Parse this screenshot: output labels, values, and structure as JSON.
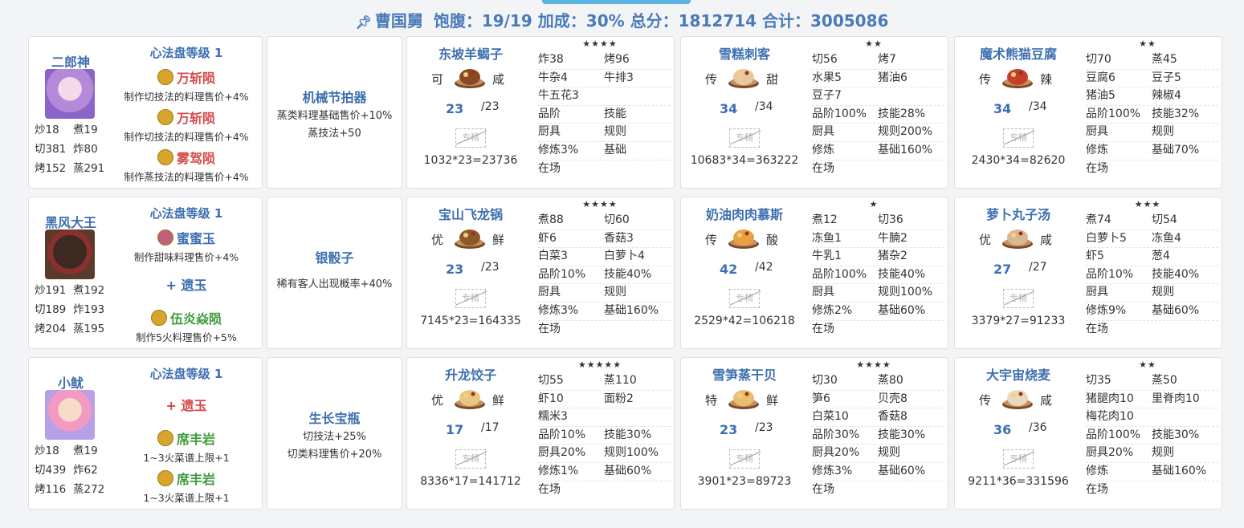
{
  "header": {
    "name": "曹国舅",
    "satiety": "饱腹：19/19",
    "bonus": "加成：30%",
    "score": "总分：1812714",
    "total": "合计：3005086"
  },
  "rows": [
    {
      "chef": {
        "name": "二郎神",
        "stats": [
          [
            "炒18",
            "煮19"
          ],
          [
            "切381",
            "炸80"
          ],
          [
            "烤152",
            "蒸291"
          ]
        ],
        "disk_title": "心法盘等级 1",
        "jades": [
          {
            "name": "万斩陨",
            "desc": "制作切技法的料理售价+4%"
          },
          {
            "name": "万斩陨",
            "desc": "制作切技法的料理售价+4%"
          },
          {
            "name": "雾驾陨",
            "desc": "制作蒸技法的料理售价+4%"
          }
        ]
      },
      "equip": {
        "name": "机械节拍器",
        "desc": [
          "蒸类料理基础售价+10%",
          "蒸技法+50"
        ]
      },
      "recipes": [
        {
          "name": "东坡羊蝎子",
          "stars": "★★★★",
          "tag1": "可",
          "tag2": "咸",
          "qty": "23",
          "max": "23",
          "nofan": "专精",
          "formula": "1032*23=23736",
          "rows": [
            [
              "炸38",
              "烤96"
            ],
            [
              "牛杂4",
              "牛排3"
            ],
            [
              "牛五花3",
              ""
            ],
            [
              "品阶",
              "技能"
            ],
            [
              "厨具",
              "规则"
            ],
            [
              "修炼3%",
              "基础"
            ],
            [
              "在场",
              ""
            ]
          ]
        },
        {
          "name": "雪糕刺客",
          "stars": "★★",
          "tag1": "传",
          "tag2": "甜",
          "qty": "34",
          "max": "34",
          "nofan": "专精",
          "formula": "10683*34=363222",
          "rows": [
            [
              "切56",
              "烤7"
            ],
            [
              "水果5",
              "猪油6"
            ],
            [
              "豆子7",
              ""
            ],
            [
              "品阶100%",
              "技能28%"
            ],
            [
              "厨具",
              "规则200%"
            ],
            [
              "修炼",
              "基础160%"
            ],
            [
              "在场",
              ""
            ]
          ]
        },
        {
          "name": "魔术熊猫豆腐",
          "stars": "★★",
          "tag1": "传",
          "tag2": "辣",
          "qty": "34",
          "max": "34",
          "nofan": "专精",
          "formula": "2430*34=82620",
          "rows": [
            [
              "切70",
              "蒸45"
            ],
            [
              "豆腐6",
              "豆子5"
            ],
            [
              "猪油5",
              "辣椒4"
            ],
            [
              "品阶100%",
              "技能32%"
            ],
            [
              "厨具",
              "规则"
            ],
            [
              "修炼",
              "基础70%"
            ],
            [
              "在场",
              ""
            ]
          ]
        }
      ]
    },
    {
      "chef": {
        "name": "黑风大王",
        "stats": [
          [
            "炒191",
            "煮192"
          ],
          [
            "切189",
            "炸193"
          ],
          [
            "烤204",
            "蒸195"
          ]
        ],
        "disk_title": "心法盘等级 1",
        "jades": [
          {
            "name": "蜜蜜玉",
            "desc": "制作甜味料理售价+4%"
          },
          {
            "name": "+ 遗玉",
            "desc": ""
          },
          {
            "name": "伍炎焱陨",
            "desc": "制作5火料理售价+5%"
          }
        ]
      },
      "equip": {
        "name": "银骰子",
        "desc": [
          "稀有客人出现概率+40%"
        ]
      },
      "recipes": [
        {
          "name": "宝山飞龙锅",
          "stars": "★★★★",
          "tag1": "优",
          "tag2": "鲜",
          "qty": "23",
          "max": "23",
          "nofan": "专精",
          "formula": "7145*23=164335",
          "rows": [
            [
              "煮88",
              "切60"
            ],
            [
              "虾6",
              "香菇3"
            ],
            [
              "白菜3",
              "白萝卜4"
            ],
            [
              "品阶10%",
              "技能40%"
            ],
            [
              "厨具",
              "规则"
            ],
            [
              "修炼3%",
              "基础160%"
            ],
            [
              "在场",
              ""
            ]
          ]
        },
        {
          "name": "奶油肉肉慕斯",
          "stars": "★",
          "tag1": "传",
          "tag2": "酸",
          "qty": "42",
          "max": "42",
          "nofan": "专精",
          "formula": "2529*42=106218",
          "rows": [
            [
              "煮12",
              "切36"
            ],
            [
              "冻鱼1",
              "牛腩2"
            ],
            [
              "牛乳1",
              "猪杂2"
            ],
            [
              "品阶100%",
              "技能40%"
            ],
            [
              "厨具",
              "规则100%"
            ],
            [
              "修炼2%",
              "基础60%"
            ],
            [
              "在场",
              ""
            ]
          ]
        },
        {
          "name": "萝卜丸子汤",
          "stars": "★★★",
          "tag1": "优",
          "tag2": "咸",
          "qty": "27",
          "max": "27",
          "nofan": "专精",
          "formula": "3379*27=91233",
          "rows": [
            [
              "煮74",
              "切54"
            ],
            [
              "白萝卜5",
              "冻鱼4"
            ],
            [
              "虾5",
              "葱4"
            ],
            [
              "品阶10%",
              "技能40%"
            ],
            [
              "厨具",
              "规则"
            ],
            [
              "修炼9%",
              "基础60%"
            ],
            [
              "在场",
              ""
            ]
          ]
        }
      ]
    },
    {
      "chef": {
        "name": "小鱿",
        "stats": [
          [
            "炒18",
            "煮19"
          ],
          [
            "切439",
            "炸62"
          ],
          [
            "烤116",
            "蒸272"
          ]
        ],
        "disk_title": "心法盘等级 1",
        "jades": [
          {
            "name": "+ 遗玉",
            "desc": ""
          },
          {
            "name": "席丰岩",
            "desc": "1~3火菜谱上限+1"
          },
          {
            "name": "席丰岩",
            "desc": "1~3火菜谱上限+1"
          }
        ]
      },
      "equip": {
        "name": "生长宝瓶",
        "desc": [
          "切技法+25%",
          "切类料理售价+20%"
        ]
      },
      "recipes": [
        {
          "name": "升龙饺子",
          "stars": "★★★★★",
          "tag1": "优",
          "tag2": "鲜",
          "qty": "17",
          "max": "17",
          "nofan": "专精",
          "formula": "8336*17=141712",
          "rows": [
            [
              "切55",
              "蒸110"
            ],
            [
              "虾10",
              "面粉2"
            ],
            [
              "糯米3",
              ""
            ],
            [
              "品阶10%",
              "技能30%"
            ],
            [
              "厨具20%",
              "规则100%"
            ],
            [
              "修炼1%",
              "基础60%"
            ],
            [
              "在场",
              ""
            ]
          ]
        },
        {
          "name": "雪笋蒸干贝",
          "stars": "★★★★",
          "tag1": "特",
          "tag2": "鲜",
          "qty": "23",
          "max": "23",
          "nofan": "专精",
          "formula": "3901*23=89723",
          "rows": [
            [
              "切30",
              "蒸80"
            ],
            [
              "笋6",
              "贝壳8"
            ],
            [
              "白菜10",
              "香菇8"
            ],
            [
              "品阶30%",
              "技能30%"
            ],
            [
              "厨具20%",
              "规则"
            ],
            [
              "修炼3%",
              "基础60%"
            ],
            [
              "在场",
              ""
            ]
          ]
        },
        {
          "name": "大宇宙烧麦",
          "stars": "★★",
          "tag1": "传",
          "tag2": "咸",
          "qty": "36",
          "max": "36",
          "nofan": "专精",
          "formula": "9211*36=331596",
          "rows": [
            [
              "切35",
              "蒸50"
            ],
            [
              "猪腿肉10",
              "里脊肉10"
            ],
            [
              "梅花肉10",
              ""
            ],
            [
              "品阶100%",
              "技能30%"
            ],
            [
              "厨具20%",
              "规则"
            ],
            [
              "修炼",
              "基础160%"
            ],
            [
              "在场",
              ""
            ]
          ]
        }
      ]
    }
  ]
}
